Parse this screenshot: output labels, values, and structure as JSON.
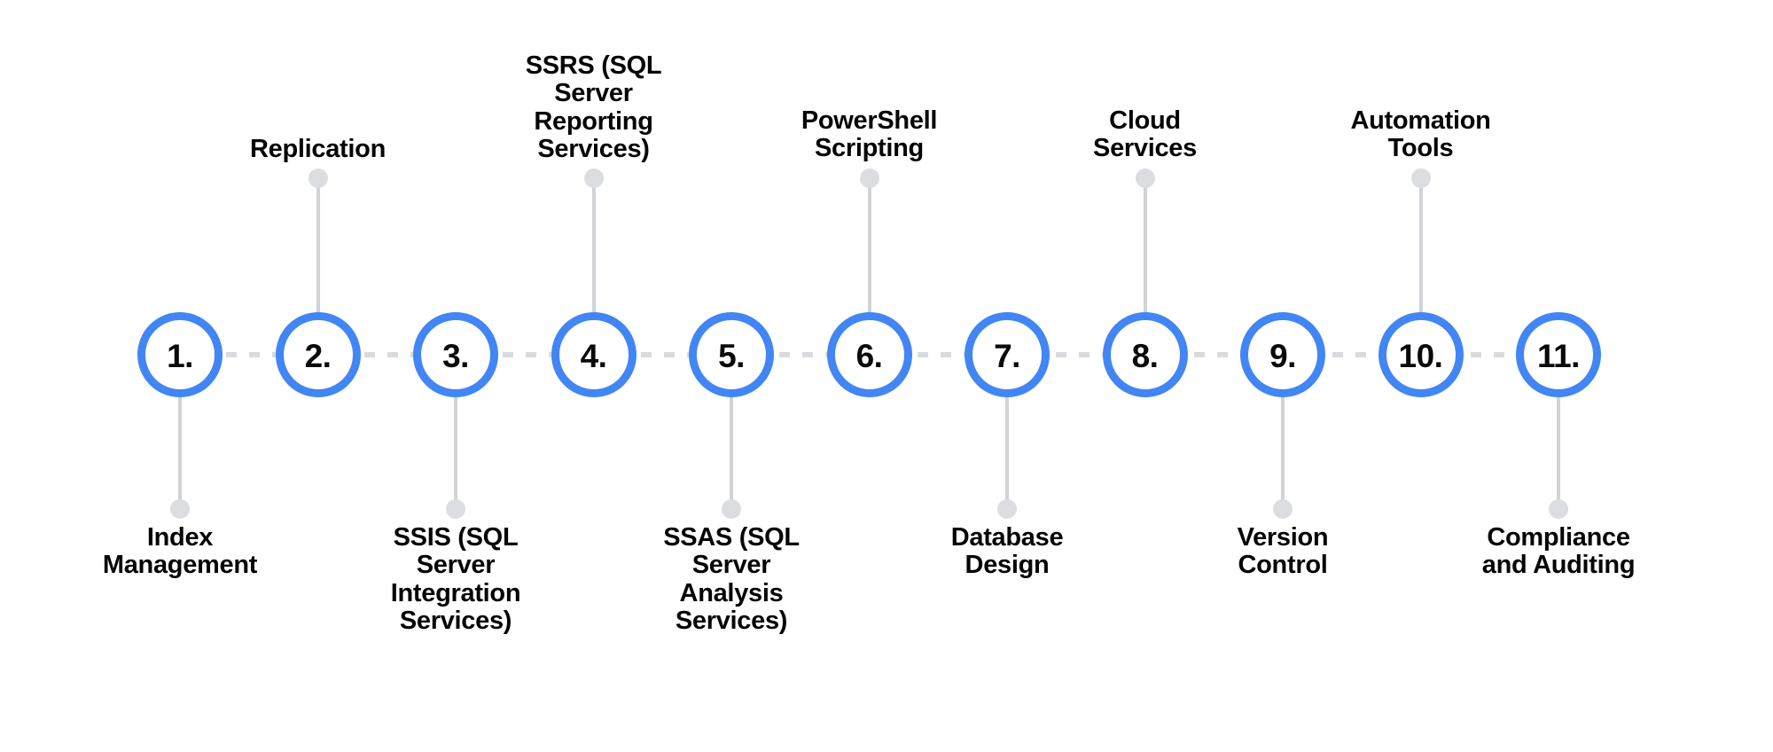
{
  "diagram": {
    "type": "numbered-timeline",
    "orientation": "horizontal",
    "accent_color": "#4285f4",
    "connector_color": "#d2d3d7",
    "dot_color": "#dcdde1",
    "text_color": "#050505",
    "background_color": "#ffffff",
    "step_count": 11
  },
  "steps": [
    {
      "number": "1.",
      "label": "Index\nManagement",
      "label_position": "below"
    },
    {
      "number": "2.",
      "label": "Replication",
      "label_position": "above"
    },
    {
      "number": "3.",
      "label": "SSIS (SQL\nServer\nIntegration\nServices)",
      "label_position": "below"
    },
    {
      "number": "4.",
      "label": "SSRS (SQL\nServer\nReporting\nServices)",
      "label_position": "above"
    },
    {
      "number": "5.",
      "label": "SSAS (SQL\nServer\nAnalysis\nServices)",
      "label_position": "below"
    },
    {
      "number": "6.",
      "label": "PowerShell\nScripting",
      "label_position": "above"
    },
    {
      "number": "7.",
      "label": "Database\nDesign",
      "label_position": "below"
    },
    {
      "number": "8.",
      "label": "Cloud\nServices",
      "label_position": "above"
    },
    {
      "number": "9.",
      "label": "Version\nControl",
      "label_position": "below"
    },
    {
      "number": "10.",
      "label": "Automation\nTools",
      "label_position": "above"
    },
    {
      "number": "11.",
      "label": "Compliance\nand Auditing",
      "label_position": "below"
    }
  ]
}
